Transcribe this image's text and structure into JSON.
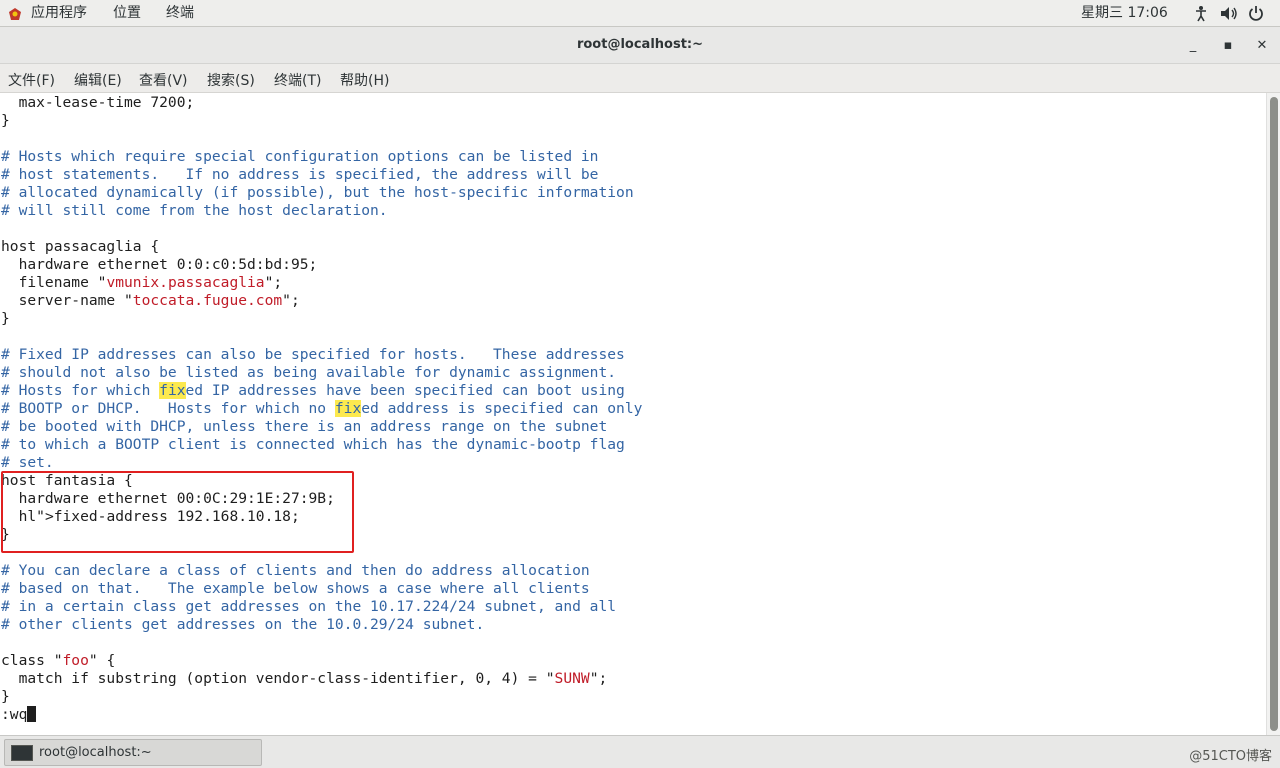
{
  "topbar": {
    "apps": "应用程序",
    "places": "位置",
    "terminal": "终端",
    "clock": "星期三 17:06",
    "icons": [
      "accessibility-icon",
      "volume-icon",
      "power-icon"
    ]
  },
  "window": {
    "title": "root@localhost:~",
    "minimize": "_",
    "maximize": "▪",
    "close": "✕"
  },
  "menu": [
    "文件(F)",
    "编辑(E)",
    "查看(V)",
    "搜索(S)",
    "终端(T)",
    "帮助(H)"
  ],
  "terminal": {
    "lines": [
      "  max-lease-time 7200;",
      "}",
      "",
      "# Hosts which require special configuration options can be listed in",
      "# host statements.   If no address is specified, the address will be",
      "# allocated dynamically (if possible), but the host-specific information",
      "# will still come from the host declaration.",
      "",
      "host passacaglia {",
      "  hardware ethernet 0:0:c0:5d:bd:95;",
      "  filename \"vmunix.passacaglia\";",
      "  server-name \"toccata.fugue.com\";",
      "}",
      "",
      "# Fixed IP addresses can also be specified for hosts.   These addresses",
      "# should not also be listed as being available for dynamic assignment.",
      "# Hosts for which fixed IP addresses have been specified can boot using",
      "# BOOTP or DHCP.   Hosts for which no fixed address is specified can only",
      "# be booted with DHCP, unless there is an address range on the subnet",
      "# to which a BOOTP client is connected which has the dynamic-bootp flag",
      "# set.",
      "host fantasia {",
      "  hardware ethernet 00:0C:29:1E:27:9B;",
      "  fixed-address 192.168.10.18;",
      "}",
      "",
      "# You can declare a class of clients and then do address allocation",
      "# based on that.   The example below shows a case where all clients",
      "# in a certain class get addresses on the 10.17.224/24 subnet, and all",
      "# other clients get addresses on the 10.0.29/24 subnet.",
      "",
      "class \"foo\" {",
      "  match if substring (option vendor-class-identifier, 0, 4) = \"SUNW\";",
      "}",
      ":wq"
    ],
    "search_highlight": "fix"
  },
  "taskbar": {
    "task_label": "root@localhost:~",
    "watermark": "@51CTO博客"
  },
  "colors": {
    "comment": "#3465a4",
    "string": "#c01c28",
    "highlight": "#fce94f",
    "annotation_box": "#e02020"
  }
}
